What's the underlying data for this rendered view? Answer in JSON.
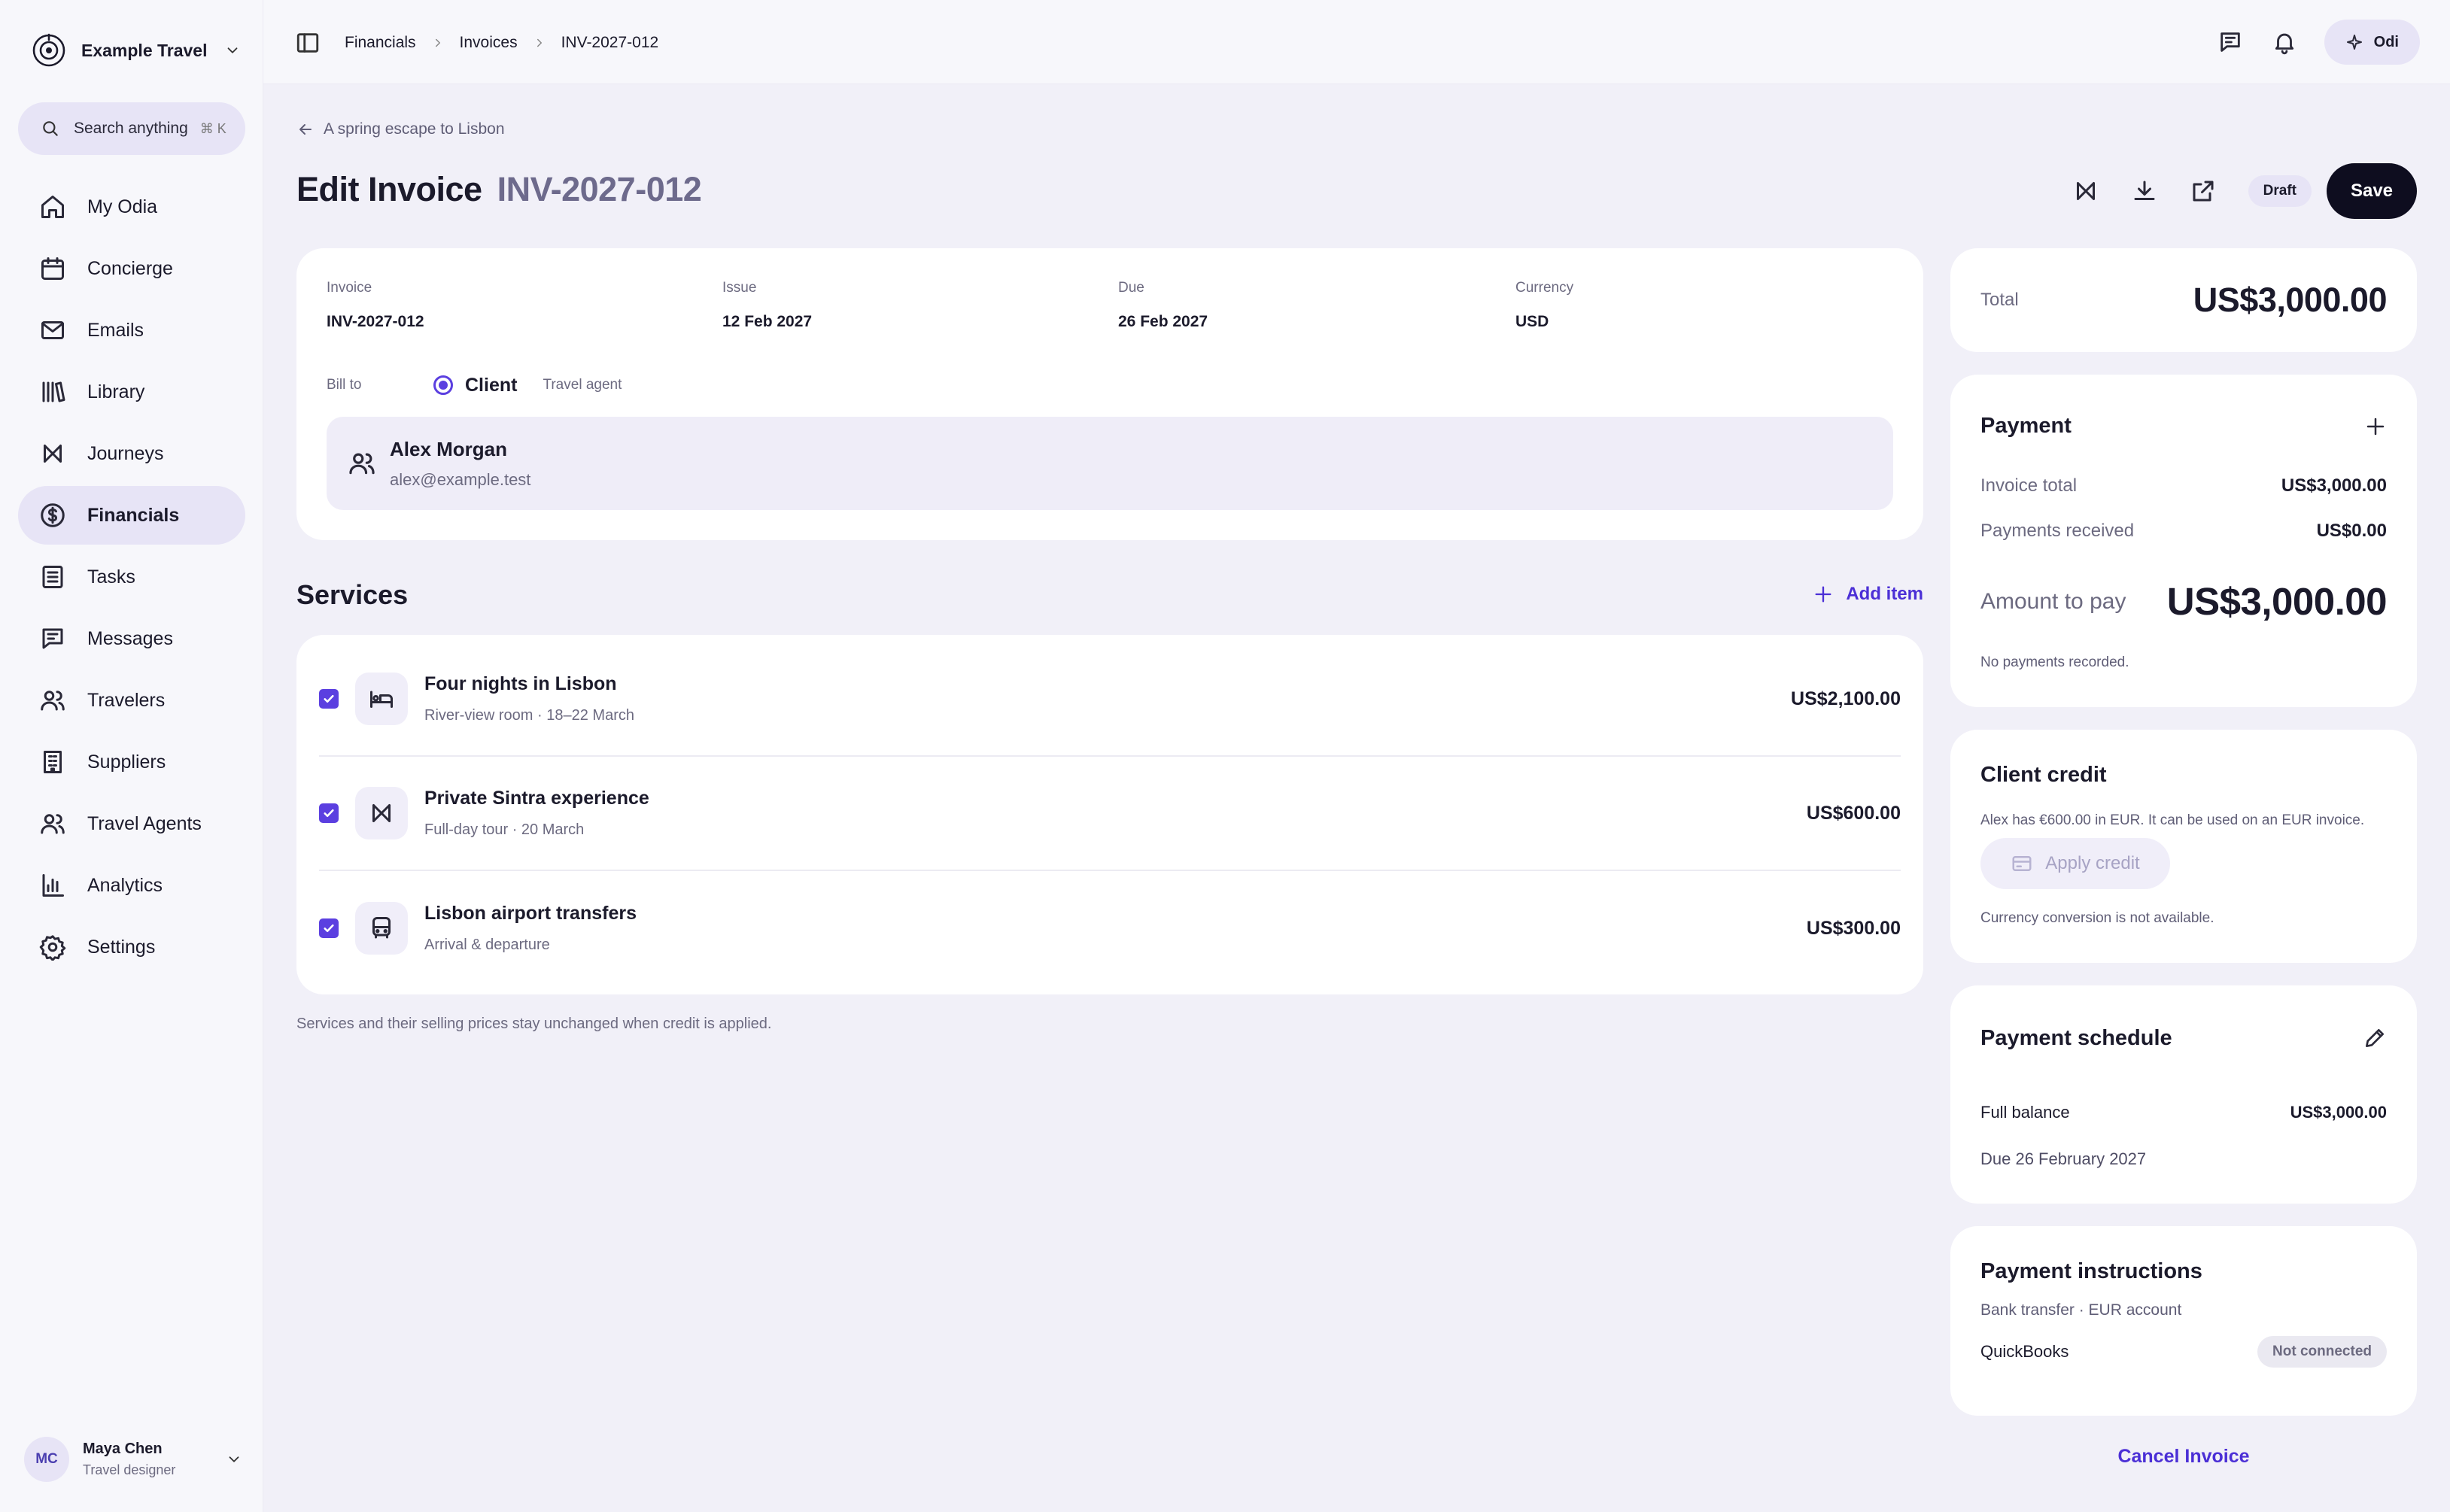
{
  "sidebar": {
    "brand": "Example Travel",
    "search": {
      "label": "Search anything",
      "shortcut": "⌘ K"
    },
    "items": [
      {
        "label": "My Odia",
        "icon": "home-icon"
      },
      {
        "label": "Concierge",
        "icon": "calendar-icon"
      },
      {
        "label": "Emails",
        "icon": "mail-icon"
      },
      {
        "label": "Library",
        "icon": "library-icon"
      },
      {
        "label": "Journeys",
        "icon": "journey-icon"
      },
      {
        "label": "Financials",
        "icon": "dollar-icon",
        "active": true
      },
      {
        "label": "Tasks",
        "icon": "tasks-icon"
      },
      {
        "label": "Messages",
        "icon": "message-icon"
      },
      {
        "label": "Travelers",
        "icon": "users-icon"
      },
      {
        "label": "Suppliers",
        "icon": "building-icon"
      },
      {
        "label": "Travel Agents",
        "icon": "users-icon"
      },
      {
        "label": "Analytics",
        "icon": "bar-chart-icon"
      },
      {
        "label": "Settings",
        "icon": "gear-icon"
      }
    ],
    "user": {
      "initials": "MC",
      "name": "Maya Chen",
      "role": "Travel designer"
    }
  },
  "topbar": {
    "breadcrumbs": [
      "Financials",
      "Invoices",
      "INV-2027-012"
    ],
    "assistant_label": "Odi"
  },
  "page": {
    "back_label": "A spring escape to Lisbon",
    "title": "Edit Invoice",
    "title_number": "INV-2027-012",
    "status": "Draft",
    "save_label": "Save"
  },
  "invoice": {
    "fields": [
      {
        "label": "Invoice",
        "value": "INV-2027-012"
      },
      {
        "label": "Issue",
        "value": "12 Feb 2027"
      },
      {
        "label": "Due",
        "value": "26 Feb 2027"
      },
      {
        "label": "Currency",
        "value": "USD"
      }
    ],
    "bill_to_label": "Bill to",
    "bill_to_options": [
      "Client",
      "Travel agent"
    ],
    "client": {
      "name": "Alex Morgan",
      "email": "alex@example.test"
    }
  },
  "services": {
    "title": "Services",
    "add_label": "Add item",
    "items": [
      {
        "name": "Four nights in Lisbon",
        "desc": "River-view room · 18–22 March",
        "price": "US$2,100.00",
        "icon": "bed-icon",
        "checked": true
      },
      {
        "name": "Private Sintra experience",
        "desc": "Full-day tour · 20 March",
        "price": "US$600.00",
        "icon": "journey-icon",
        "checked": true
      },
      {
        "name": "Lisbon airport transfers",
        "desc": "Arrival & departure",
        "price": "US$300.00",
        "icon": "bus-icon",
        "checked": true
      }
    ],
    "note": "Services and their selling prices stay unchanged when credit is applied."
  },
  "summary": {
    "total_label": "Total",
    "total_value": "US$3,000.00",
    "payment": {
      "title": "Payment",
      "invoice_total_label": "Invoice total",
      "invoice_total": "US$3,000.00",
      "received_label": "Payments received",
      "received": "US$0.00",
      "amount_label": "Amount to pay",
      "amount": "US$3,000.00",
      "note": "No payments recorded."
    },
    "credit": {
      "title": "Client credit",
      "text": "Alex has €600.00 in EUR. It can be used on an EUR invoice.",
      "apply_label": "Apply credit",
      "note": "Currency conversion is not available."
    },
    "schedule": {
      "title": "Payment schedule",
      "row_label": "Full balance",
      "row_value": "US$3,000.00",
      "due": "Due 26 February 2027"
    },
    "instructions": {
      "title": "Payment instructions",
      "method": "Bank transfer · EUR account",
      "integration": "QuickBooks",
      "integration_status": "Not connected"
    },
    "cancel_label": "Cancel Invoice"
  },
  "colors": {
    "accent": "#5b3fe0",
    "link": "#4b2fd6",
    "background": "#f1f0f8",
    "dark": "#0e0d1f"
  }
}
